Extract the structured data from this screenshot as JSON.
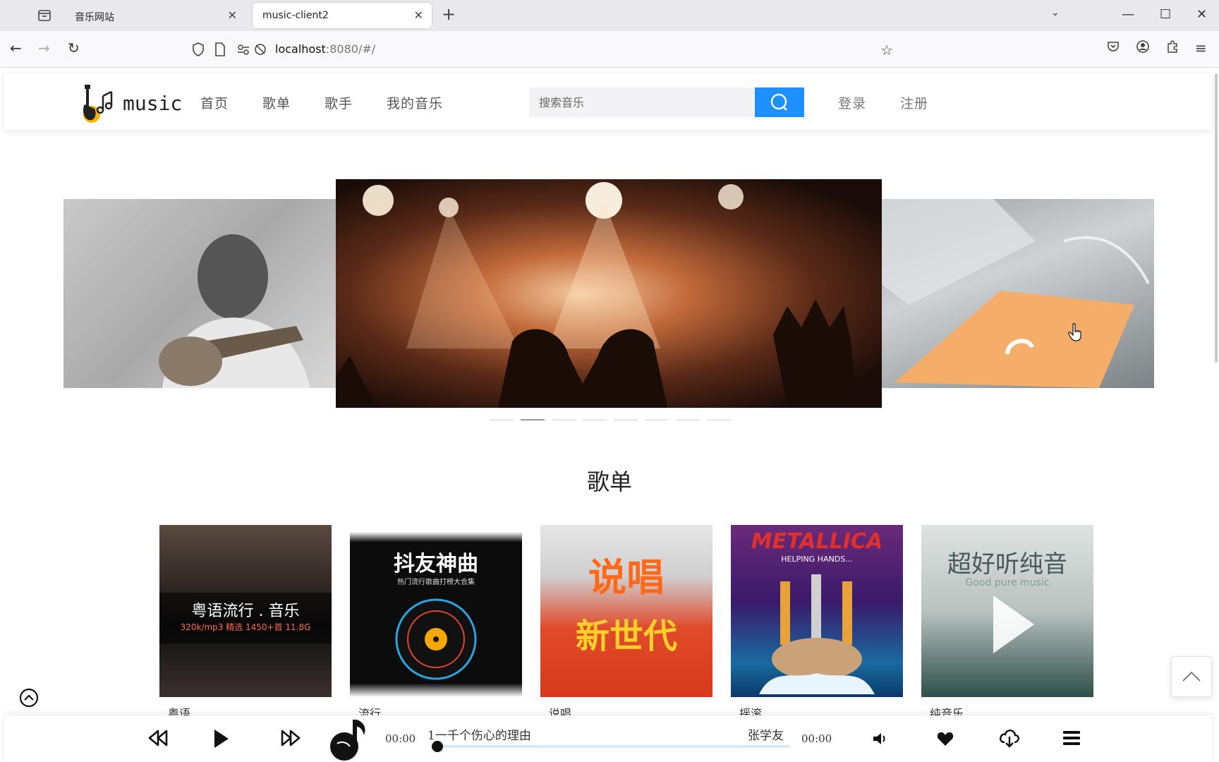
{
  "browser": {
    "tabs": [
      {
        "label": "音乐网站",
        "active": false
      },
      {
        "label": "music-client2",
        "active": true
      }
    ],
    "url_host": "localhost",
    "url_rest": ":8080/#/"
  },
  "site": {
    "logo_text": "music",
    "nav": [
      "首页",
      "歌单",
      "歌手",
      "我的音乐"
    ],
    "search_placeholder": "搜索音乐",
    "login": "登录",
    "register": "注册",
    "brand_color": "#1e90ff"
  },
  "carousel": {
    "active_index": 1,
    "total": 8
  },
  "playlists": {
    "title": "歌单",
    "items": [
      {
        "label": "粤语",
        "cover_text": "粤语流行 . 音乐",
        "cover_sub": "320k/mp3  精选 1450+首  11.8G"
      },
      {
        "label": "流行",
        "cover_text": "抖友神曲",
        "cover_sub": "热门流行歌曲打榜大合集"
      },
      {
        "label": "说唱",
        "cover_text": "说唱",
        "cover_sub": "新世代"
      },
      {
        "label": "摇滚",
        "cover_text": "METALLICA",
        "cover_sub": "HELPING HANDS..."
      },
      {
        "label": "纯音乐",
        "cover_text": "超好听纯音",
        "cover_sub": "Good pure music"
      }
    ]
  },
  "player": {
    "current_time": "00:00",
    "total_time": "00:00",
    "song": "1一千个伤心的理由",
    "artist": "张学友",
    "progress": 0.0
  }
}
